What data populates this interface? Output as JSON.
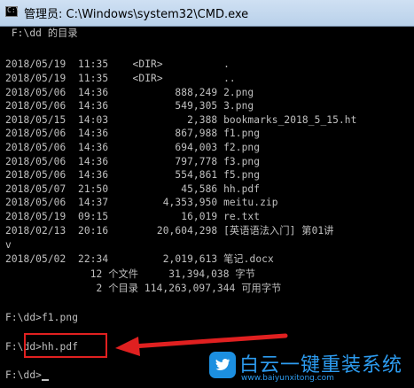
{
  "window": {
    "title": "管理员: C:\\Windows\\system32\\CMD.exe"
  },
  "console": {
    "lines": [
      " F:\\dd 的目录",
      "",
      "2018/05/19  11:35    <DIR>          .",
      "2018/05/19  11:35    <DIR>          ..",
      "2018/05/06  14:36           888,249 2.png",
      "2018/05/06  14:36           549,305 3.png",
      "2018/05/15  14:03             2,388 bookmarks_2018_5_15.ht",
      "2018/05/06  14:36           867,988 f1.png",
      "2018/05/06  14:36           694,003 f2.png",
      "2018/05/06  14:36           797,778 f3.png",
      "2018/05/06  14:36           554,861 f5.png",
      "2018/05/07  21:50            45,586 hh.pdf",
      "2018/05/06  14:37         4,353,950 meitu.zip",
      "2018/05/19  09:15            16,019 re.txt",
      "2018/02/13  20:16        20,604,298 [英语语法入门] 第01讲",
      "v",
      "2018/05/02  22:34         2,019,613 笔记.docx",
      "              12 个文件     31,394,038 字节",
      "               2 个目录 114,263,097,344 可用字节",
      "",
      "F:\\dd>f1.png",
      "",
      "F:\\dd>hh.pdf",
      "",
      "F:\\dd>"
    ]
  },
  "watermark": {
    "name": "白云一键重装系统",
    "url": "www.baiyunxitong.com",
    "color": "#2d9cf0"
  },
  "annotation": {
    "color": "#e02020"
  }
}
